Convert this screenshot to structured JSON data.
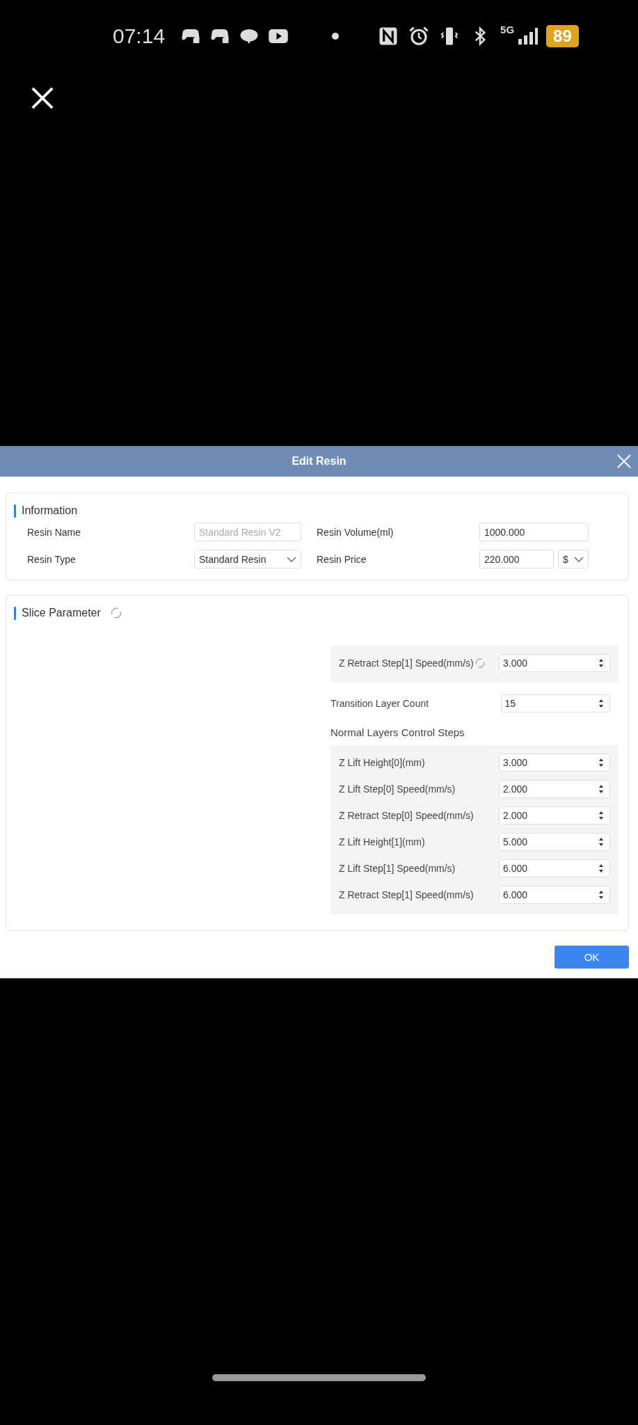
{
  "status_bar": {
    "time": "07:14",
    "network": "5G",
    "battery": "89"
  },
  "dialog": {
    "title": "Edit Resin",
    "information": {
      "title": "Information",
      "resin_name": {
        "label": "Resin Name",
        "value": "Standard Resin V2",
        "disabled": true
      },
      "resin_type": {
        "label": "Resin Type",
        "value": "Standard Resin"
      },
      "resin_volume": {
        "label": "Resin Volume(ml)",
        "value": "1000.000"
      },
      "resin_price": {
        "label": "Resin Price",
        "value": "220.000",
        "currency": "$"
      }
    },
    "slice_parameter": {
      "title": "Slice Parameter",
      "items": [
        {
          "kind": "group",
          "rows": [
            {
              "label": "Z Retract Step[1] Speed(mm/s)",
              "value": "3.000",
              "reset": true
            }
          ]
        },
        {
          "kind": "spin",
          "label": "Transition Layer Count",
          "value": "15"
        },
        {
          "kind": "heading",
          "text": "Normal Layers Control Steps"
        },
        {
          "kind": "group",
          "rows": [
            {
              "label": "Z Lift Height[0](mm)",
              "value": "3.000",
              "reset": false
            },
            {
              "label": "Z Lift Step[0] Speed(mm/s)",
              "value": "2.000",
              "reset": false
            },
            {
              "label": "Z Retract Step[0] Speed(mm/s)",
              "value": "2.000",
              "reset": false
            },
            {
              "label": "Z Lift Height[1](mm)",
              "value": "5.000",
              "reset": false
            },
            {
              "label": "Z Lift Step[1] Speed(mm/s)",
              "value": "6.000",
              "reset": false
            },
            {
              "label": "Z Retract Step[1] Speed(mm/s)",
              "value": "6.000",
              "reset": false
            }
          ]
        }
      ]
    },
    "buttons": [
      "OK"
    ]
  }
}
